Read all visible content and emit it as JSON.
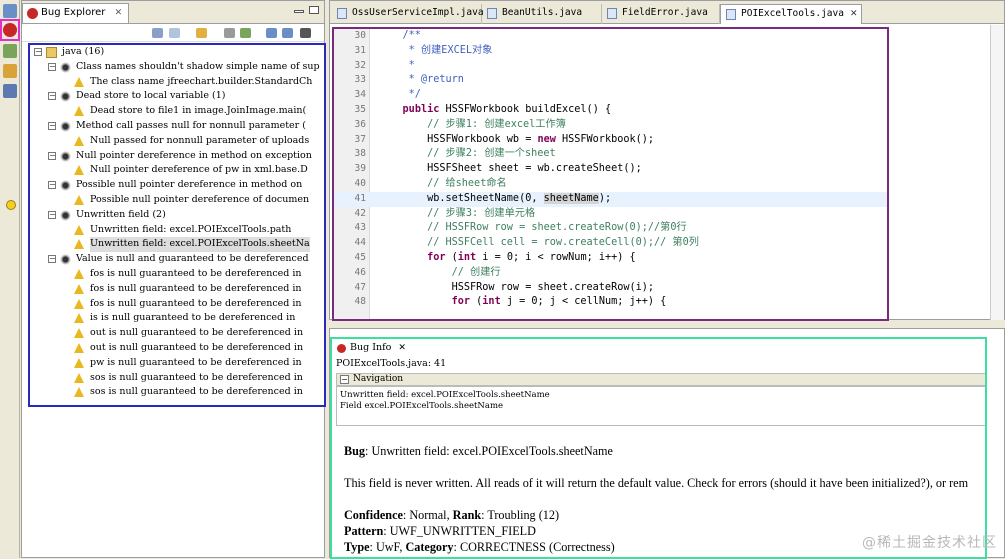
{
  "bug_explorer": {
    "tab_label": "Bug Explorer",
    "tree": [
      {
        "level": 0,
        "icon": "folder-icon",
        "expand": "−",
        "label": "java (16)"
      },
      {
        "level": 1,
        "icon": "bug-icon",
        "expand": "−",
        "label": "Class names shouldn't shadow simple name of sup"
      },
      {
        "level": 2,
        "icon": "warning-icon",
        "expand": "",
        "label": "The class name jfreechart.builder.StandardCh"
      },
      {
        "level": 1,
        "icon": "bug-icon",
        "expand": "−",
        "label": "Dead store to local variable (1)"
      },
      {
        "level": 2,
        "icon": "warning-icon",
        "expand": "",
        "label": "Dead store to file1 in image.JoinImage.main("
      },
      {
        "level": 1,
        "icon": "bug-icon",
        "expand": "−",
        "label": "Method call passes null for nonnull parameter ("
      },
      {
        "level": 2,
        "icon": "warning-icon",
        "expand": "",
        "label": "Null passed for nonnull parameter of uploads"
      },
      {
        "level": 1,
        "icon": "bug-icon",
        "expand": "−",
        "label": "Null pointer dereference in method on exception"
      },
      {
        "level": 2,
        "icon": "warning-icon",
        "expand": "",
        "label": "Null pointer dereference of pw in xml.base.D"
      },
      {
        "level": 1,
        "icon": "bug-icon",
        "expand": "−",
        "label": "Possible null pointer dereference in method on"
      },
      {
        "level": 2,
        "icon": "warning-icon",
        "expand": "",
        "label": "Possible null pointer dereference of documen"
      },
      {
        "level": 1,
        "icon": "bug-icon",
        "expand": "−",
        "label": "Unwritten field (2)"
      },
      {
        "level": 2,
        "icon": "warning-icon",
        "expand": "",
        "label": "Unwritten field: excel.POIExcelTools.path"
      },
      {
        "level": 2,
        "icon": "warning-icon",
        "expand": "",
        "label": "Unwritten field: excel.POIExcelTools.sheetNa",
        "selected": true
      },
      {
        "level": 1,
        "icon": "bug-icon",
        "expand": "−",
        "label": "Value is null and guaranteed to be dereferenced"
      },
      {
        "level": 2,
        "icon": "warning-icon",
        "expand": "",
        "label": "fos is null guaranteed to be dereferenced in"
      },
      {
        "level": 2,
        "icon": "warning-icon",
        "expand": "",
        "label": "fos is null guaranteed to be dereferenced in"
      },
      {
        "level": 2,
        "icon": "warning-icon",
        "expand": "",
        "label": "fos is null guaranteed to be dereferenced in"
      },
      {
        "level": 2,
        "icon": "warning-icon",
        "expand": "",
        "label": "is is null guaranteed to be dereferenced in"
      },
      {
        "level": 2,
        "icon": "warning-icon",
        "expand": "",
        "label": "out is null guaranteed to be dereferenced in"
      },
      {
        "level": 2,
        "icon": "warning-icon",
        "expand": "",
        "label": "out is null guaranteed to be dereferenced in"
      },
      {
        "level": 2,
        "icon": "warning-icon",
        "expand": "",
        "label": "pw is null guaranteed to be dereferenced in"
      },
      {
        "level": 2,
        "icon": "warning-icon",
        "expand": "",
        "label": "sos is null guaranteed to be dereferenced in"
      },
      {
        "level": 2,
        "icon": "warning-icon",
        "expand": "",
        "label": "sos is null guaranteed to be dereferenced in"
      }
    ]
  },
  "editor": {
    "tabs": [
      {
        "label": "OssUserServiceImpl.java",
        "active": false
      },
      {
        "label": "BeanUtils.java",
        "active": false
      },
      {
        "label": "FieldError.java",
        "active": false
      },
      {
        "label": "POIExcelTools.java",
        "active": true
      }
    ],
    "lines": [
      {
        "n": "30",
        "code": "    /**",
        "cls": "jd"
      },
      {
        "n": "31",
        "code": "     * 创建EXCEL对象",
        "cls": "jd"
      },
      {
        "n": "32",
        "code": "     *",
        "cls": "jd"
      },
      {
        "n": "33",
        "code": "     * @return",
        "cls": "jd"
      },
      {
        "n": "34",
        "code": "     */",
        "cls": "jd"
      },
      {
        "n": "35",
        "code": "    public HSSFWorkbook buildExcel() {",
        "cls": ""
      },
      {
        "n": "36",
        "code": "        // 步骤1: 创建excel工作簿",
        "cls": "cm"
      },
      {
        "n": "37",
        "code": "        HSSFWorkbook wb = new HSSFWorkbook();",
        "cls": ""
      },
      {
        "n": "38",
        "code": "        // 步骤2: 创建一个sheet",
        "cls": "cm"
      },
      {
        "n": "39",
        "code": "        HSSFSheet sheet = wb.createSheet();",
        "cls": ""
      },
      {
        "n": "40",
        "code": "        // 给sheet命名",
        "cls": "cm"
      },
      {
        "n": "41",
        "code": "        wb.setSheetName(0, sheetName);",
        "cls": "",
        "highlight": true
      },
      {
        "n": "42",
        "code": "        // 步骤3: 创建单元格",
        "cls": "cm"
      },
      {
        "n": "43",
        "code": "        // HSSFRow row = sheet.createRow(0);//第0行",
        "cls": "cm"
      },
      {
        "n": "44",
        "code": "        // HSSFCell cell = row.createCell(0);// 第0列",
        "cls": "cm"
      },
      {
        "n": "45",
        "code": "        for (int i = 0; i < rowNum; i++) {",
        "cls": ""
      },
      {
        "n": "46",
        "code": "            // 创建行",
        "cls": "cm"
      },
      {
        "n": "47",
        "code": "            HSSFRow row = sheet.createRow(i);",
        "cls": ""
      },
      {
        "n": "48",
        "code": "            for (int j = 0; j < cellNum; j++) {",
        "cls": ""
      }
    ]
  },
  "bug_info": {
    "tab_label": "Bug Info",
    "location": "POIExcelTools.java: 41",
    "navigation_label": "Navigation",
    "navigation_items": [
      "Unwritten field: excel.POIExcelTools.sheetName",
      "Field excel.POIExcelTools.sheetName"
    ],
    "bug_key": "Bug",
    "bug_value": ": Unwritten field: excel.POIExcelTools.sheetName",
    "description": "This field is never written.  All reads of it will return the default value. Check for errors (should it have been initialized?), or rem",
    "confidence_key": "Confidence",
    "confidence_value": ": Normal, ",
    "rank_key": "Rank",
    "rank_value": ": Troubling (12)",
    "pattern_key": "Pattern",
    "pattern_value": ": UWF_UNWRITTEN_FIELD",
    "type_key": "Type",
    "type_value": ": UwF, ",
    "category_key": "Category",
    "category_value": ": CORRECTNESS (Correctness)"
  },
  "watermark": "@稀土掘金技术社区",
  "colors": {
    "highlight_magenta": "#e030c8",
    "tree_border_blue": "#2a2ab8",
    "code_border_purple": "#7a2a7e",
    "info_border_green": "#3be0a0",
    "keyword": "#7f0055",
    "comment": "#3f7f5f"
  }
}
